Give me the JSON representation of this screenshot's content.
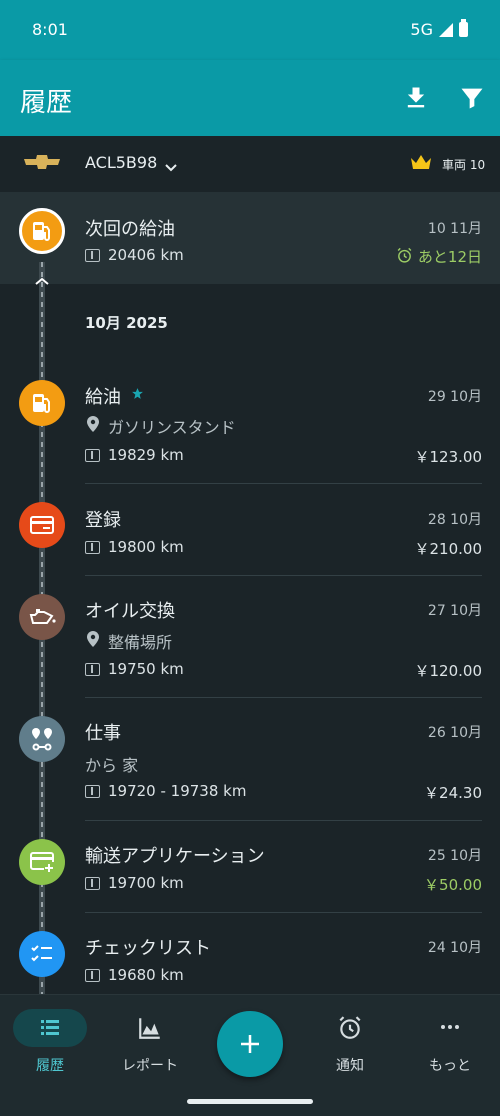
{
  "status_bar": {
    "time": "8:01",
    "network": "5G"
  },
  "app_bar": {
    "title": "履歴",
    "icons": [
      "download-icon",
      "filter-icon"
    ]
  },
  "vehicle": {
    "plate": "ACL5B98",
    "count_label": "車両 10",
    "brand_icon": "chevrolet-logo"
  },
  "next_fill": {
    "title": "次回の給油",
    "date": "10 11月",
    "odometer": "20406 km",
    "alert": "あと12日",
    "color": "#f39c12"
  },
  "month_header": "10月 2025",
  "entries": [
    {
      "title": "給油",
      "date": "29 10月",
      "location": "ガソリンスタンド",
      "odometer": "19829 km",
      "price": "￥123.00",
      "color": "#f39c12",
      "icon": "fuel-pump-icon"
    },
    {
      "title": "登録",
      "date": "28 10月",
      "odometer": "19800 km",
      "price": "￥210.00",
      "color": "#e64a19",
      "icon": "card-icon"
    },
    {
      "title": "オイル交換",
      "date": "27 10月",
      "location": "整備場所",
      "odometer": "19750 km",
      "price": "￥120.00",
      "color": "#795548",
      "icon": "oil-can-icon"
    },
    {
      "title": "仕事",
      "date": "26 10月",
      "route": "から 家",
      "odometer": "19720 - 19738 km",
      "price": "￥24.30",
      "color": "#607d8b",
      "icon": "route-icon"
    },
    {
      "title": "輸送アプリケーション",
      "date": "25 10月",
      "odometer": "19700 km",
      "price": "￥50.00",
      "color": "#8bc34a",
      "icon": "card-plus-icon"
    },
    {
      "title": "チェックリスト",
      "date": "24 10月",
      "odometer": "19680 km",
      "color": "#2196f3",
      "icon": "checklist-icon"
    }
  ],
  "bottom_nav": [
    {
      "label": "履歴",
      "icon": "history-list-icon",
      "active": true
    },
    {
      "label": "レポート",
      "icon": "chart-icon",
      "active": false
    },
    {
      "label": "通知",
      "icon": "alarm-icon",
      "active": false
    },
    {
      "label": "もっと",
      "icon": "more-icon",
      "active": false
    }
  ],
  "colors": {
    "primary": "#0a9aa6",
    "background": "#1b2428",
    "accent_green": "#9ccc65"
  }
}
